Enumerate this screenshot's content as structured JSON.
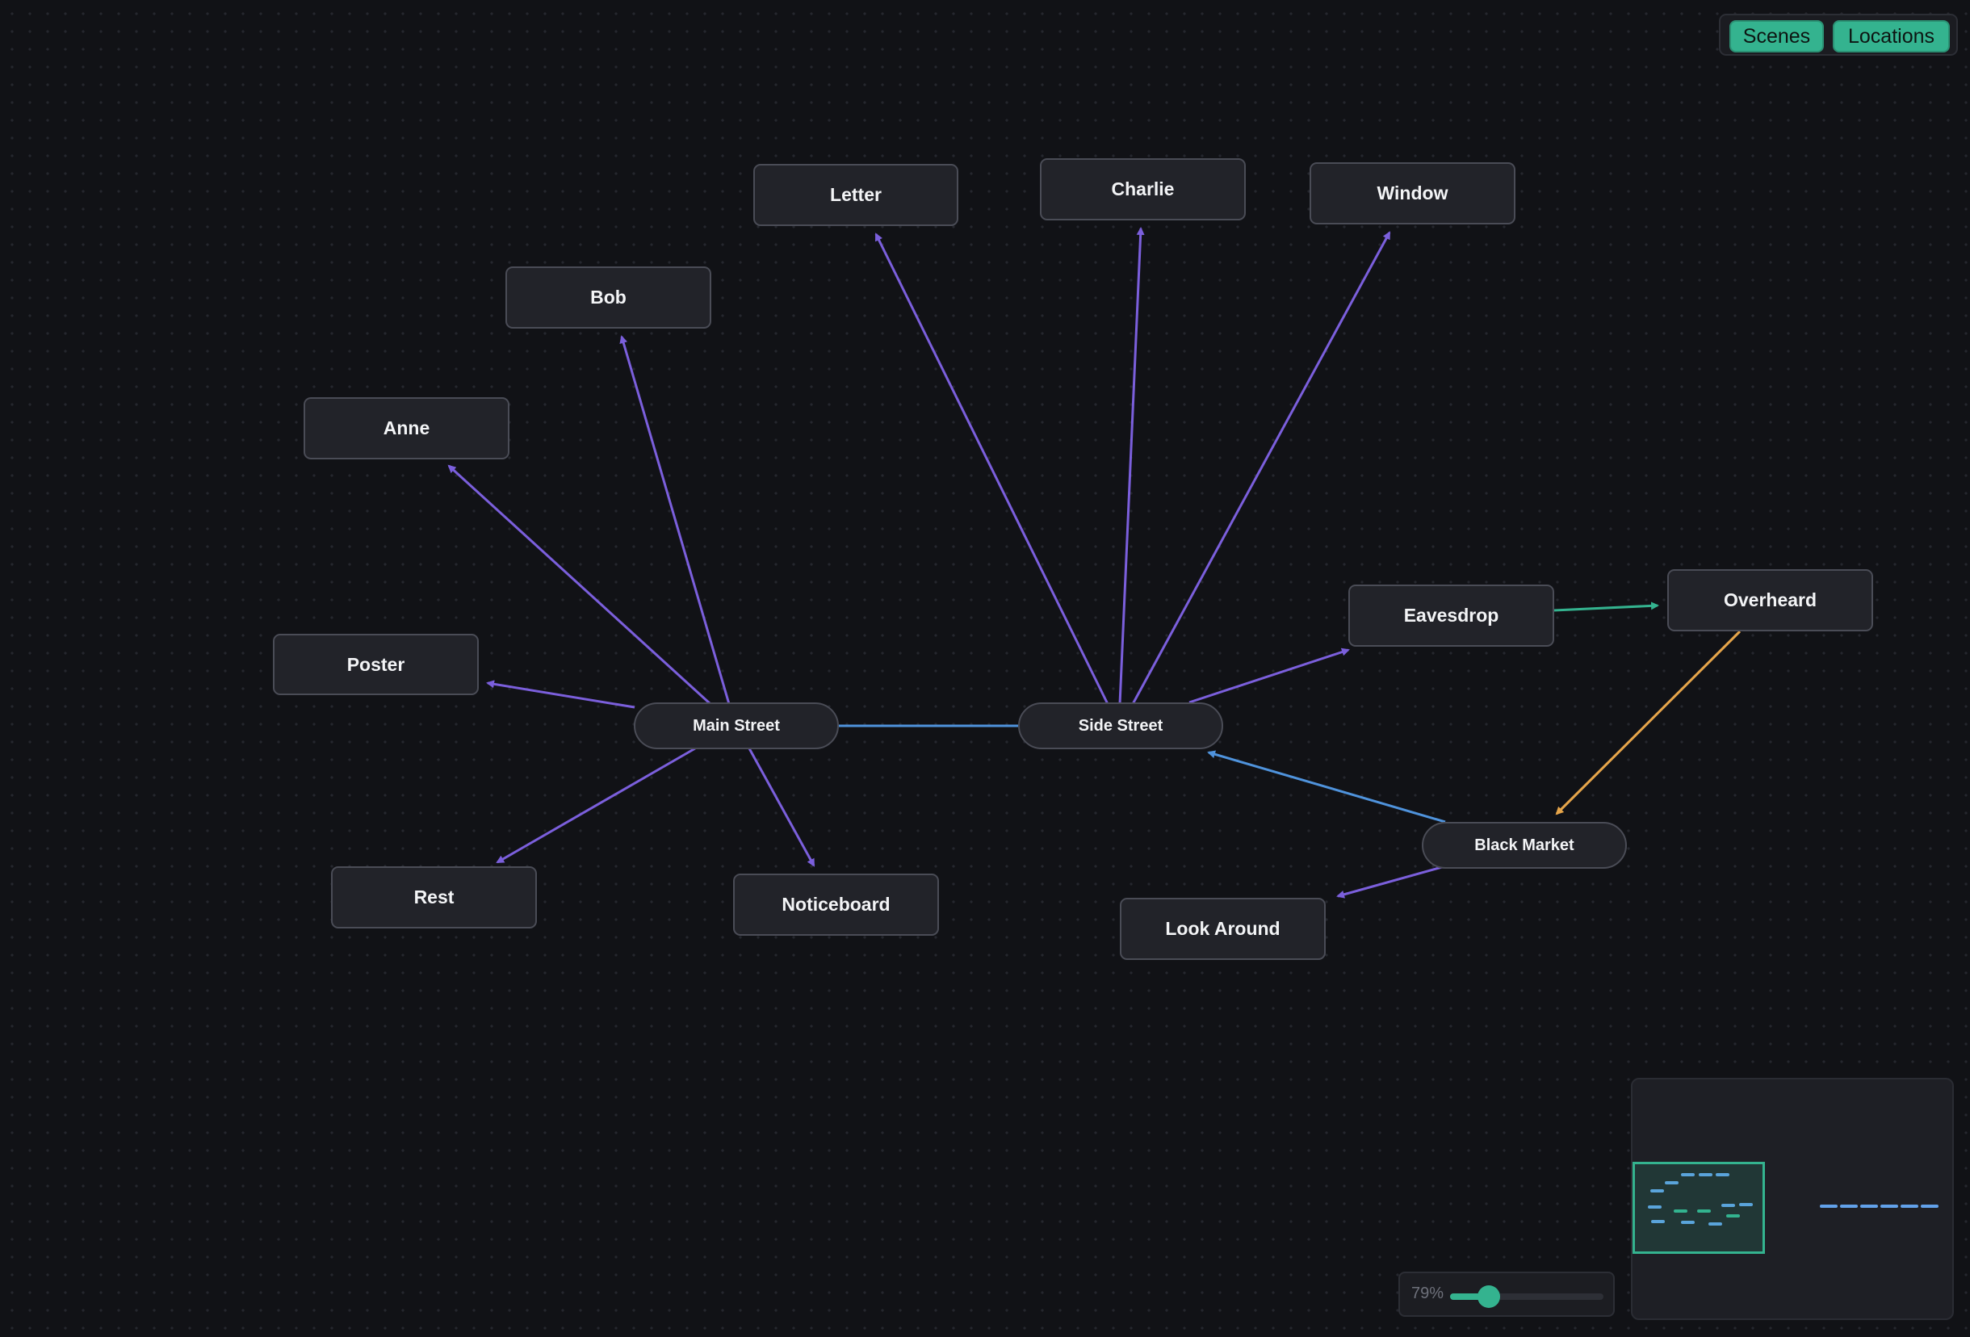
{
  "mode_toggle": {
    "scenes_label": "Scenes",
    "locations_label": "Locations"
  },
  "nodes": {
    "letter": "Letter",
    "charlie": "Charlie",
    "window": "Window",
    "bob": "Bob",
    "anne": "Anne",
    "poster": "Poster",
    "eavesdrop": "Eavesdrop",
    "overheard": "Overheard",
    "rest": "Rest",
    "noticeboard": "Noticeboard",
    "look_around": "Look Around",
    "main_street": "Main Street",
    "side_street": "Side Street",
    "black_market": "Black Market"
  },
  "edges": [
    {
      "from": "main_street",
      "to": "anne",
      "kind": "scene"
    },
    {
      "from": "main_street",
      "to": "bob",
      "kind": "scene"
    },
    {
      "from": "main_street",
      "to": "poster",
      "kind": "scene"
    },
    {
      "from": "main_street",
      "to": "rest",
      "kind": "scene"
    },
    {
      "from": "main_street",
      "to": "noticeboard",
      "kind": "scene"
    },
    {
      "from": "main_street",
      "to": "side_street",
      "kind": "location"
    },
    {
      "from": "side_street",
      "to": "letter",
      "kind": "scene"
    },
    {
      "from": "side_street",
      "to": "charlie",
      "kind": "scene"
    },
    {
      "from": "side_street",
      "to": "window",
      "kind": "scene"
    },
    {
      "from": "side_street",
      "to": "eavesdrop",
      "kind": "scene"
    },
    {
      "from": "eavesdrop",
      "to": "overheard",
      "kind": "flow"
    },
    {
      "from": "overheard",
      "to": "black_market",
      "kind": "link"
    },
    {
      "from": "black_market",
      "to": "side_street",
      "kind": "location"
    },
    {
      "from": "black_market",
      "to": "look_around",
      "kind": "scene"
    }
  ],
  "colors": {
    "scene_edge": "#7b5fdc",
    "location_edge": "#4f93dc",
    "flow_edge": "#34b38f",
    "link_edge": "#e6a54a",
    "accent": "#34b38f",
    "background": "#111216",
    "node_fill": "#222329"
  },
  "zoom": {
    "label": "79%",
    "level": 0.79,
    "slider_fraction": 0.25
  },
  "minimap": {
    "viewport_label": "minimap-viewport"
  }
}
